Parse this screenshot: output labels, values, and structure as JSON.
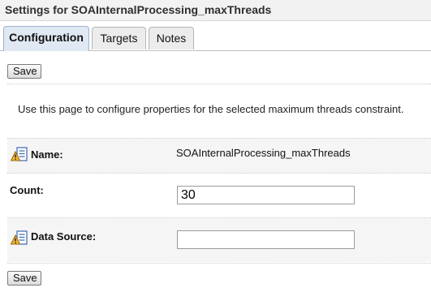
{
  "header": {
    "title": "Settings for SOAInternalProcessing_maxThreads"
  },
  "tabs": [
    {
      "label": "Configuration",
      "active": true
    },
    {
      "label": "Targets",
      "active": false
    },
    {
      "label": "Notes",
      "active": false
    }
  ],
  "toolbar": {
    "save_label": "Save"
  },
  "description": "Use this page to configure properties for the selected maximum threads constraint.",
  "fields": {
    "name": {
      "label": "Name:",
      "value": "SOAInternalProcessing_maxThreads",
      "icon": "config-info-icon"
    },
    "count": {
      "label": "Count:",
      "value": "30"
    },
    "data_source": {
      "label": "Data Source:",
      "value": "",
      "icon": "config-info-icon"
    }
  },
  "colors": {
    "active_tab_bg": "#dfe8f3",
    "title_bar_bg": "#f2f2f2",
    "row_shade": "#f5f5f5"
  }
}
